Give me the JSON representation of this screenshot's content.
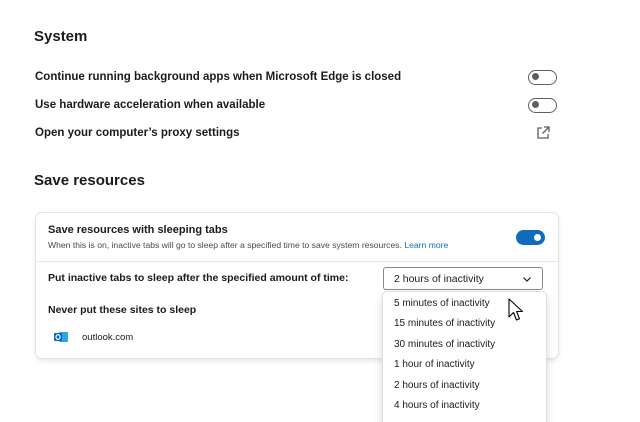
{
  "system": {
    "title": "System",
    "rows": [
      {
        "label": "Continue running background apps when Microsoft Edge is closed",
        "state": "off"
      },
      {
        "label": "Use hardware acceleration when available",
        "state": "off"
      },
      {
        "label": "Open your computer’s proxy settings",
        "icon": "external-link-icon"
      }
    ]
  },
  "save_resources": {
    "title": "Save resources",
    "sleeping_tabs": {
      "title": "Save resources with sleeping tabs",
      "description": "When this is on, inactive tabs will go to sleep after a specified time to save system resources.",
      "learn_more": "Learn more",
      "state": "on"
    },
    "sleep_after": {
      "label": "Put inactive tabs to sleep after the specified amount of time:",
      "selected": "2 hours of inactivity",
      "options": [
        "5 minutes of inactivity",
        "15 minutes of inactivity",
        "30 minutes of inactivity",
        "1 hour of inactivity",
        "2 hours of inactivity",
        "4 hours of inactivity"
      ]
    },
    "never_sleep": {
      "title": "Never put these sites to sleep",
      "sites": [
        {
          "name": "outlook.com",
          "icon": "outlook-icon"
        }
      ]
    }
  },
  "colors": {
    "accent": "#0f6cbd",
    "toggle_off_border": "#5f5f5f",
    "outlook_blue": "#0a64c8"
  }
}
